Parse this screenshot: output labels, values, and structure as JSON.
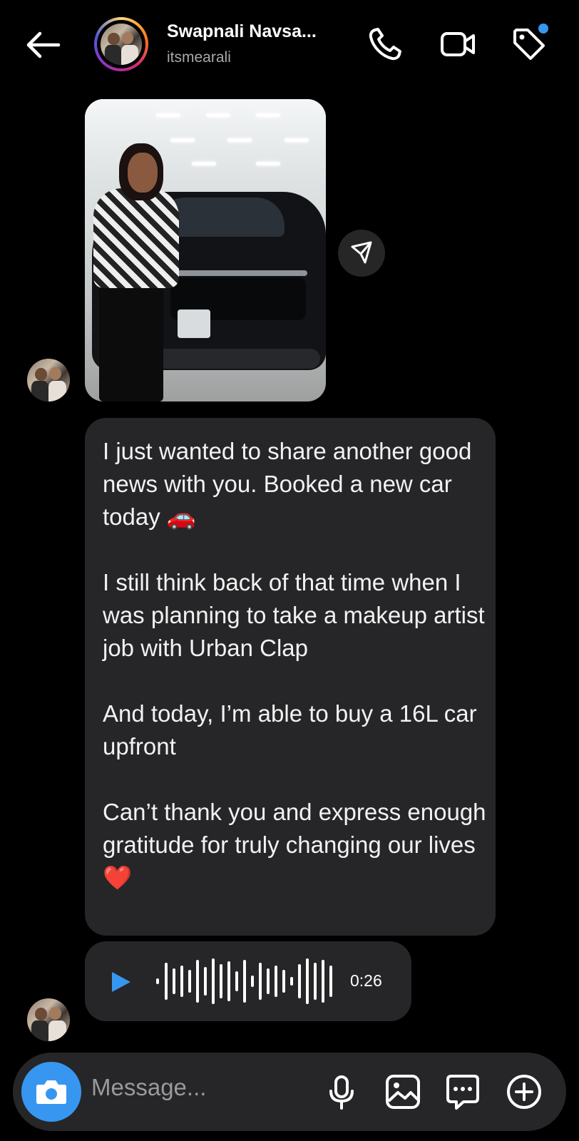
{
  "header": {
    "name": "Swapnali Navsa...",
    "username": "itsmearali"
  },
  "thread": {
    "message_text": "I just wanted to share another good news with you. Booked a new car today 🚗\n\nI still think back of that time when I was planning to take a makeup artist job with Urban Clap\n\nAnd today, I’m able to buy a 16L car upfront\n\nCan’t thank you and express enough gratitude for truly changing our lives ❤️",
    "voice_duration": "0:26"
  },
  "composer": {
    "placeholder": "Message..."
  },
  "colors": {
    "accent": "#3797f0",
    "bubble": "#262628",
    "background": "#000000"
  }
}
